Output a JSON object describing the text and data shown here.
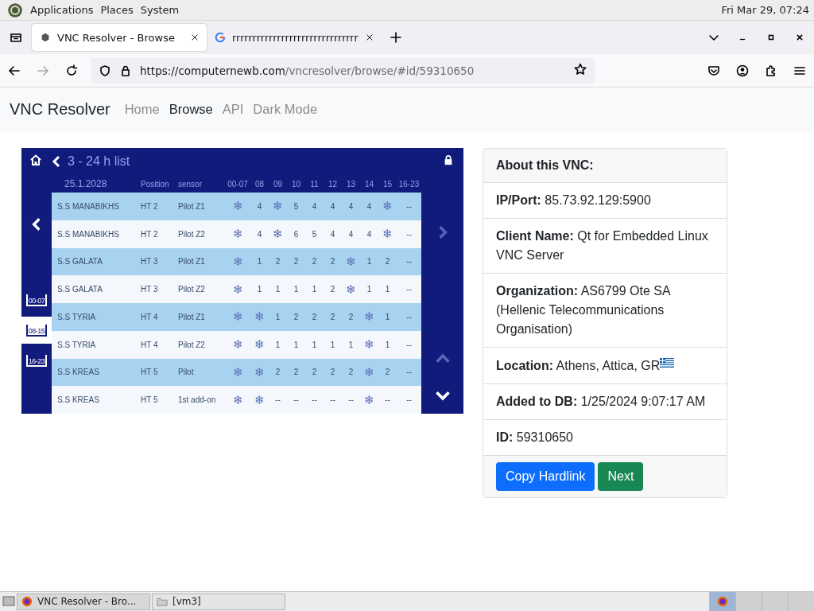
{
  "top_panel": {
    "menus": [
      "Applications",
      "Places",
      "System"
    ],
    "clock": "Fri Mar 29, 07:24"
  },
  "browser": {
    "tabs": [
      {
        "title": "VNC Resolver - Browse",
        "selected": true
      },
      {
        "title": "rrrrrrrrrrrrrrrrrrrrrrrrrrrrrrr",
        "selected": false
      }
    ],
    "url": {
      "domain": "https://computernewb.com",
      "path": "/vncresolver/browse/#id/59310650"
    }
  },
  "navbar": {
    "brand": "VNC Resolver",
    "links": [
      {
        "label": "Home",
        "selected": false
      },
      {
        "label": "Browse",
        "selected": true
      },
      {
        "label": "API",
        "selected": false
      },
      {
        "label": "Dark Mode",
        "selected": false
      }
    ]
  },
  "vnc_screen": {
    "title": "3 - 24 h list",
    "columns": [
      "25.1.2028",
      "Position",
      "sensor",
      "00-07",
      "08",
      "09",
      "10",
      "11",
      "12",
      "13",
      "14",
      "15",
      "16-23"
    ],
    "rows": [
      {
        "cells": [
          "S.S MANABIKHS",
          "HT 2",
          "Pilot Z1",
          "❄",
          "4",
          "❄",
          "5",
          "4",
          "4",
          "4",
          "4",
          "❄",
          "--"
        ]
      },
      {
        "cells": [
          "S.S MANABIKHS",
          "HT 2",
          "Pilot Z2",
          "❄",
          "4",
          "❄",
          "6",
          "5",
          "4",
          "4",
          "4",
          "❄",
          "--"
        ]
      },
      {
        "cells": [
          "S.S GALATA",
          "HT 3",
          "Pilot Z1",
          "❄",
          "1",
          "2",
          "2",
          "2",
          "2",
          "❄",
          "1",
          "2",
          "--"
        ]
      },
      {
        "cells": [
          "S.S GALATA",
          "HT 3",
          "Pilot Z2",
          "❄",
          "1",
          "1",
          "1",
          "1",
          "2",
          "❄",
          "1",
          "1",
          "--"
        ]
      },
      {
        "cells": [
          "S.S TYRIA",
          "HT 4",
          "Pilot Z1",
          "❄",
          "❄",
          "1",
          "2",
          "2",
          "2",
          "2",
          "❄",
          "1",
          "--"
        ]
      },
      {
        "cells": [
          "S.S TYRIA",
          "HT 4",
          "Pilot Z2",
          "❄",
          "❄",
          "1",
          "1",
          "1",
          "1",
          "1",
          "❄",
          "1",
          "--"
        ]
      },
      {
        "cells": [
          "S.S KREAS",
          "HT 5",
          "Pilot",
          "❄",
          "❄",
          "2",
          "2",
          "2",
          "2",
          "2",
          "❄",
          "2",
          "--"
        ]
      },
      {
        "cells": [
          "S.S KREAS",
          "HT 5",
          "1st add-on",
          "❄",
          "❄",
          "--",
          "--",
          "--",
          "--",
          "--",
          "❄",
          "--",
          "--"
        ]
      }
    ],
    "shift_buttons": [
      {
        "label": "00-07",
        "selected": false
      },
      {
        "label": "08-15",
        "selected": true
      },
      {
        "label": "16-23",
        "selected": false
      }
    ],
    "prev_disabled": false,
    "next_disabled": true,
    "up_disabled": true,
    "down_disabled": false
  },
  "info_card": {
    "header": "About this VNC:",
    "fields": [
      {
        "label": "IP/Port:",
        "value": "85.73.92.129:5900"
      },
      {
        "label": "Client Name:",
        "value": "Qt for Embedded Linux VNC Server"
      },
      {
        "label": "Organization:",
        "value": "AS6799 Ote SA (Hellenic Telecommunications Organisation)"
      },
      {
        "label": "Location:",
        "value": "Athens, Attica, GR",
        "kind": "flag"
      },
      {
        "label": "Added to DB:",
        "value": "1/25/2024 9:07:17 AM"
      },
      {
        "label": "ID:",
        "value": "59310650"
      }
    ],
    "buttons": [
      {
        "label": "Copy Hardlink",
        "kind": "primary"
      },
      {
        "label": "Next",
        "kind": "success"
      }
    ]
  },
  "taskbar": {
    "items": [
      {
        "label": "VNC Resolver - Bro...",
        "kind": "browser"
      },
      {
        "label": "[vm3]",
        "kind": "folder"
      }
    ]
  }
}
